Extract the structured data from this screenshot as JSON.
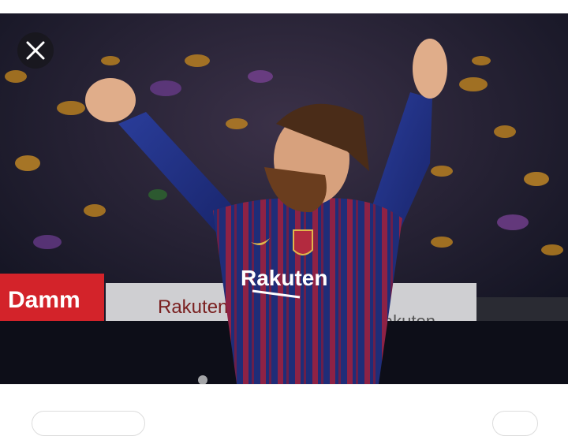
{
  "viewer": {
    "close_icon": "close-icon"
  },
  "photo": {
    "jersey_sponsor": "Rakuten",
    "board_left_text": "Damm",
    "board_mid_text": "Rakuten",
    "board_right_text": "Rakuten",
    "colors": {
      "blaugrana_blue": "#1e2f7a",
      "blaugrana_red": "#a3213f",
      "board_red": "#d3232a",
      "crowd_amber": "#c98a1e"
    }
  }
}
